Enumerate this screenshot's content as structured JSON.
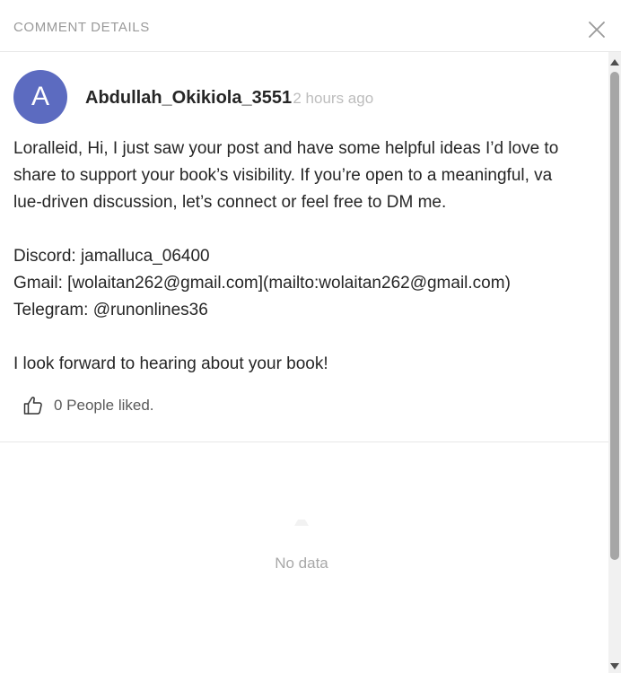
{
  "header": {
    "title": "COMMENT DETAILS"
  },
  "comment": {
    "avatar_letter": "A",
    "author": "Abdullah_Okikiola_3551",
    "time": "· 2 hours ago",
    "lines": [
      "Loralleid, Hi, I just saw your post and have some helpful ideas I’d love to",
      "share to support your book’s visibility. If you’re open to a meaningful, va",
      "lue-driven discussion, let’s connect or feel free to DM me.",
      "",
      "Discord: jamalluca_06400",
      "Gmail: [wolaitan262@gmail.com](mailto:wolaitan262@gmail.com)",
      "Telegram: @runonlines36",
      "",
      "I look forward to hearing about your book!"
    ],
    "likes_text": "0 People liked."
  },
  "replies": {
    "empty_text": "No data"
  },
  "colors": {
    "avatar": "#5c6bc0",
    "muted": "#bdbdbd",
    "divider": "#e8e8e8"
  }
}
